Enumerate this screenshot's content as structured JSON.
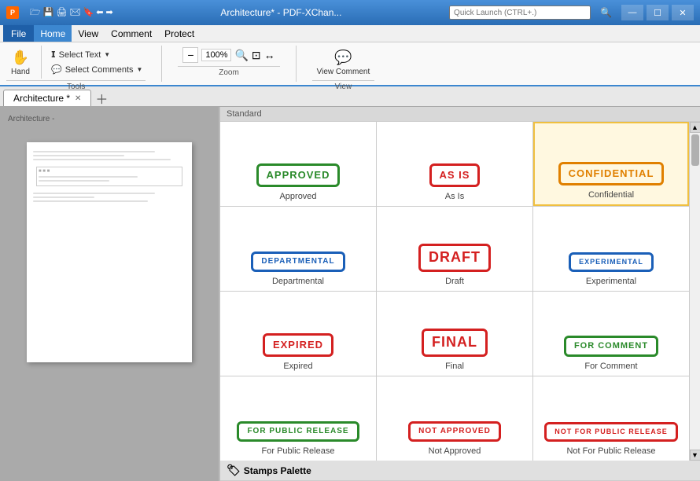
{
  "titleBar": {
    "title": "Architecture* - PDF-XChan...",
    "searchPlaceholder": "Quick Launch (CTRL+.)",
    "buttons": [
      "minimize",
      "maximize",
      "close"
    ]
  },
  "menuBar": {
    "fileLabel": "File",
    "items": [
      "Home",
      "View",
      "Comment",
      "Protect"
    ]
  },
  "ribbon": {
    "handTool": "Hand",
    "selectText": "Select Text",
    "selectComments": "Select Comments",
    "zoom": "100%",
    "toolsGroup": "Tools",
    "viewGroup": "View",
    "viewComment": "View Comment"
  },
  "tabs": [
    {
      "label": "Architecture *",
      "active": true
    },
    {
      "label": "+",
      "isAdd": true
    }
  ],
  "stampsPanel": {
    "header": "Stamps Palette",
    "sectionLabel": "Standard",
    "stamps": [
      {
        "id": "approved",
        "label": "Approved",
        "text": "APPROVED",
        "color": "green",
        "selected": false
      },
      {
        "id": "as-is",
        "label": "As Is",
        "text": "AS IS",
        "color": "red",
        "selected": false
      },
      {
        "id": "confidential",
        "label": "Confidential",
        "text": "CONFIDENTIAL",
        "color": "orange",
        "selected": true
      },
      {
        "id": "departmental",
        "label": "Departmental",
        "text": "DEPARTMENTAL",
        "color": "blue",
        "selected": false
      },
      {
        "id": "draft",
        "label": "Draft",
        "text": "DRAFT",
        "color": "red",
        "selected": false
      },
      {
        "id": "experimental",
        "label": "Experimental",
        "text": "EXPERIMENTAL",
        "color": "blue",
        "selected": false
      },
      {
        "id": "expired",
        "label": "Expired",
        "text": "EXPIRED",
        "color": "red",
        "selected": false
      },
      {
        "id": "final",
        "label": "Final",
        "text": "FINAL",
        "color": "red",
        "selected": false
      },
      {
        "id": "for-comment",
        "label": "For Comment",
        "text": "FOR COMMENT",
        "color": "green",
        "selected": false
      },
      {
        "id": "for-public-release",
        "label": "For Public Release",
        "text": "FOR PUBLIC RELEASE",
        "color": "green",
        "selected": false
      },
      {
        "id": "not-approved",
        "label": "Not Approved",
        "text": "NOT APPROVED",
        "color": "red",
        "selected": false
      },
      {
        "id": "not-for-public-release",
        "label": "Not For Public Release",
        "text": "NOT FOR PUBLIC RELEASE",
        "color": "red",
        "selected": false
      }
    ]
  },
  "statusBar": {
    "text": ""
  },
  "pageContent": {
    "miniLines": 8
  }
}
